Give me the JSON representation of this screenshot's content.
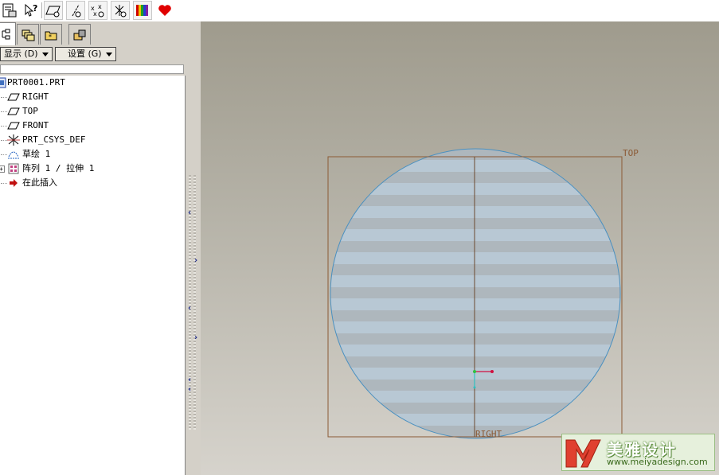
{
  "toolbar": {
    "icons": [
      "model-display-icon",
      "context-help-icon",
      "datum-plane-toggle-icon",
      "datum-axis-toggle-icon",
      "datum-point-toggle-icon",
      "coordinate-system-toggle-icon",
      "appearance-color-icon",
      "heart-icon"
    ]
  },
  "navigator": {
    "tabs": [
      "model-tree-tab",
      "layer-tree-tab",
      "folder-browser-tab",
      "favorites-tab"
    ],
    "show_menu": "显示 (D)",
    "settings_menu": "设置 (G)",
    "tree": [
      {
        "label": "PRT0001.PRT",
        "icon": "part-icon"
      },
      {
        "label": "RIGHT",
        "icon": "datum-plane-icon"
      },
      {
        "label": "TOP",
        "icon": "datum-plane-icon"
      },
      {
        "label": "FRONT",
        "icon": "datum-plane-icon"
      },
      {
        "label": "PRT_CSYS_DEF",
        "icon": "coordinate-system-icon"
      },
      {
        "label": "草绘 1",
        "icon": "sketch-icon"
      },
      {
        "label": "阵列 1 / 拉伸 1",
        "icon": "pattern-icon"
      },
      {
        "label": "在此插入",
        "icon": "insert-here-arrow-icon"
      }
    ]
  },
  "viewport": {
    "datum_labels": {
      "top": "TOP",
      "right": "RIGHT"
    },
    "colors": {
      "datum": "#8b5a35",
      "circle": "#4a90c0",
      "stripe": "#b8c8d4",
      "csys_x": "#d01040",
      "csys_y": "#30c040",
      "csys_z": "#30c0c0"
    }
  },
  "watermark": {
    "brand": "美雅设计",
    "url": "www.meiyadesign.com"
  }
}
